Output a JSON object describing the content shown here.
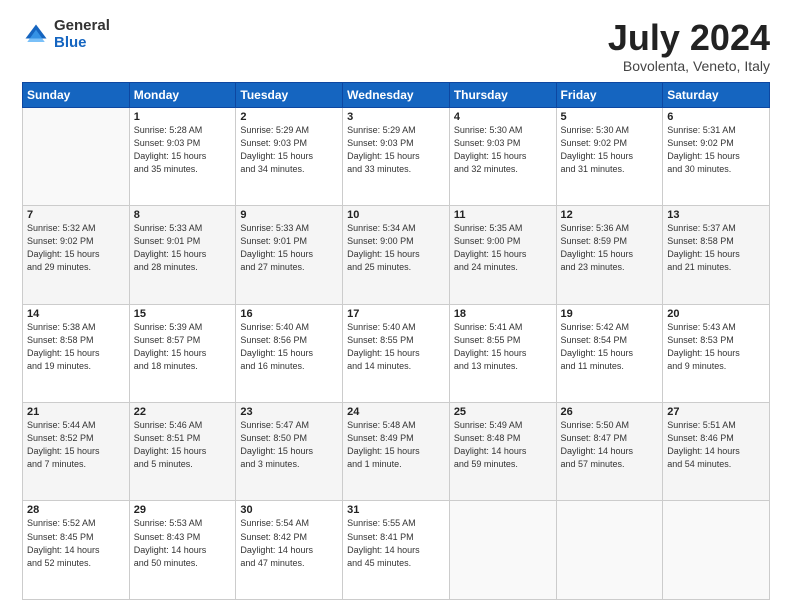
{
  "logo": {
    "general": "General",
    "blue": "Blue"
  },
  "title": "July 2024",
  "subtitle": "Bovolenta, Veneto, Italy",
  "days_of_week": [
    "Sunday",
    "Monday",
    "Tuesday",
    "Wednesday",
    "Thursday",
    "Friday",
    "Saturday"
  ],
  "weeks": [
    [
      {
        "day": "",
        "info": ""
      },
      {
        "day": "1",
        "info": "Sunrise: 5:28 AM\nSunset: 9:03 PM\nDaylight: 15 hours\nand 35 minutes."
      },
      {
        "day": "2",
        "info": "Sunrise: 5:29 AM\nSunset: 9:03 PM\nDaylight: 15 hours\nand 34 minutes."
      },
      {
        "day": "3",
        "info": "Sunrise: 5:29 AM\nSunset: 9:03 PM\nDaylight: 15 hours\nand 33 minutes."
      },
      {
        "day": "4",
        "info": "Sunrise: 5:30 AM\nSunset: 9:03 PM\nDaylight: 15 hours\nand 32 minutes."
      },
      {
        "day": "5",
        "info": "Sunrise: 5:30 AM\nSunset: 9:02 PM\nDaylight: 15 hours\nand 31 minutes."
      },
      {
        "day": "6",
        "info": "Sunrise: 5:31 AM\nSunset: 9:02 PM\nDaylight: 15 hours\nand 30 minutes."
      }
    ],
    [
      {
        "day": "7",
        "info": "Sunrise: 5:32 AM\nSunset: 9:02 PM\nDaylight: 15 hours\nand 29 minutes."
      },
      {
        "day": "8",
        "info": "Sunrise: 5:33 AM\nSunset: 9:01 PM\nDaylight: 15 hours\nand 28 minutes."
      },
      {
        "day": "9",
        "info": "Sunrise: 5:33 AM\nSunset: 9:01 PM\nDaylight: 15 hours\nand 27 minutes."
      },
      {
        "day": "10",
        "info": "Sunrise: 5:34 AM\nSunset: 9:00 PM\nDaylight: 15 hours\nand 25 minutes."
      },
      {
        "day": "11",
        "info": "Sunrise: 5:35 AM\nSunset: 9:00 PM\nDaylight: 15 hours\nand 24 minutes."
      },
      {
        "day": "12",
        "info": "Sunrise: 5:36 AM\nSunset: 8:59 PM\nDaylight: 15 hours\nand 23 minutes."
      },
      {
        "day": "13",
        "info": "Sunrise: 5:37 AM\nSunset: 8:58 PM\nDaylight: 15 hours\nand 21 minutes."
      }
    ],
    [
      {
        "day": "14",
        "info": "Sunrise: 5:38 AM\nSunset: 8:58 PM\nDaylight: 15 hours\nand 19 minutes."
      },
      {
        "day": "15",
        "info": "Sunrise: 5:39 AM\nSunset: 8:57 PM\nDaylight: 15 hours\nand 18 minutes."
      },
      {
        "day": "16",
        "info": "Sunrise: 5:40 AM\nSunset: 8:56 PM\nDaylight: 15 hours\nand 16 minutes."
      },
      {
        "day": "17",
        "info": "Sunrise: 5:40 AM\nSunset: 8:55 PM\nDaylight: 15 hours\nand 14 minutes."
      },
      {
        "day": "18",
        "info": "Sunrise: 5:41 AM\nSunset: 8:55 PM\nDaylight: 15 hours\nand 13 minutes."
      },
      {
        "day": "19",
        "info": "Sunrise: 5:42 AM\nSunset: 8:54 PM\nDaylight: 15 hours\nand 11 minutes."
      },
      {
        "day": "20",
        "info": "Sunrise: 5:43 AM\nSunset: 8:53 PM\nDaylight: 15 hours\nand 9 minutes."
      }
    ],
    [
      {
        "day": "21",
        "info": "Sunrise: 5:44 AM\nSunset: 8:52 PM\nDaylight: 15 hours\nand 7 minutes."
      },
      {
        "day": "22",
        "info": "Sunrise: 5:46 AM\nSunset: 8:51 PM\nDaylight: 15 hours\nand 5 minutes."
      },
      {
        "day": "23",
        "info": "Sunrise: 5:47 AM\nSunset: 8:50 PM\nDaylight: 15 hours\nand 3 minutes."
      },
      {
        "day": "24",
        "info": "Sunrise: 5:48 AM\nSunset: 8:49 PM\nDaylight: 15 hours\nand 1 minute."
      },
      {
        "day": "25",
        "info": "Sunrise: 5:49 AM\nSunset: 8:48 PM\nDaylight: 14 hours\nand 59 minutes."
      },
      {
        "day": "26",
        "info": "Sunrise: 5:50 AM\nSunset: 8:47 PM\nDaylight: 14 hours\nand 57 minutes."
      },
      {
        "day": "27",
        "info": "Sunrise: 5:51 AM\nSunset: 8:46 PM\nDaylight: 14 hours\nand 54 minutes."
      }
    ],
    [
      {
        "day": "28",
        "info": "Sunrise: 5:52 AM\nSunset: 8:45 PM\nDaylight: 14 hours\nand 52 minutes."
      },
      {
        "day": "29",
        "info": "Sunrise: 5:53 AM\nSunset: 8:43 PM\nDaylight: 14 hours\nand 50 minutes."
      },
      {
        "day": "30",
        "info": "Sunrise: 5:54 AM\nSunset: 8:42 PM\nDaylight: 14 hours\nand 47 minutes."
      },
      {
        "day": "31",
        "info": "Sunrise: 5:55 AM\nSunset: 8:41 PM\nDaylight: 14 hours\nand 45 minutes."
      },
      {
        "day": "",
        "info": ""
      },
      {
        "day": "",
        "info": ""
      },
      {
        "day": "",
        "info": ""
      }
    ]
  ]
}
